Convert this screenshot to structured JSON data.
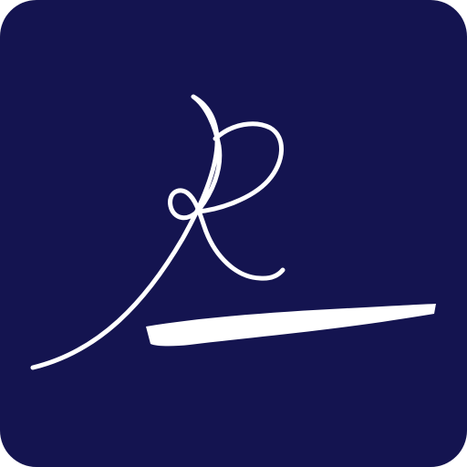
{
  "app_icon": {
    "icon_name": "signature-r-icon",
    "logo_letter": "R",
    "colors": {
      "background": "#141450",
      "stroke": "#ffffff"
    }
  }
}
